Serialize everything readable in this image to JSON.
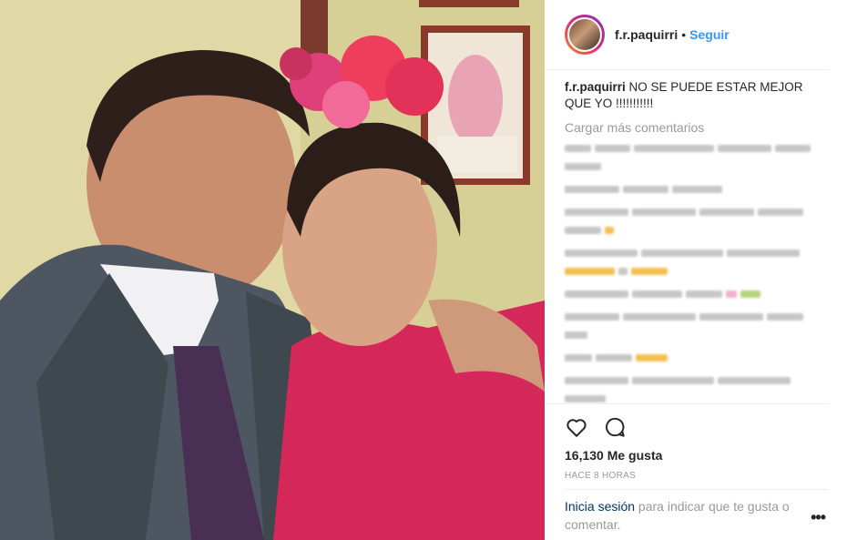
{
  "post": {
    "username": "f.r.paquirri",
    "separator": "•",
    "follow_label": "Seguir",
    "caption_user": "f.r.paquirri",
    "caption_text": " NO SE PUEDE ESTAR MEJOR QUE YO !!!!!!!!!!!",
    "load_more": "Cargar más comentarios",
    "likes": "16,130 Me gusta",
    "time_ago": "HACE 8 HORAS",
    "login_link": "Inicia sesión",
    "login_text": " para indicar que te gusta o comentar.",
    "more_icon": "•••"
  },
  "icons": {
    "like": "heart-outline-icon",
    "comment": "comment-bubble-icon",
    "more": "more-options-icon"
  },
  "colors": {
    "link_blue": "#3897f0",
    "dark_link": "#003569",
    "muted": "#999999"
  }
}
